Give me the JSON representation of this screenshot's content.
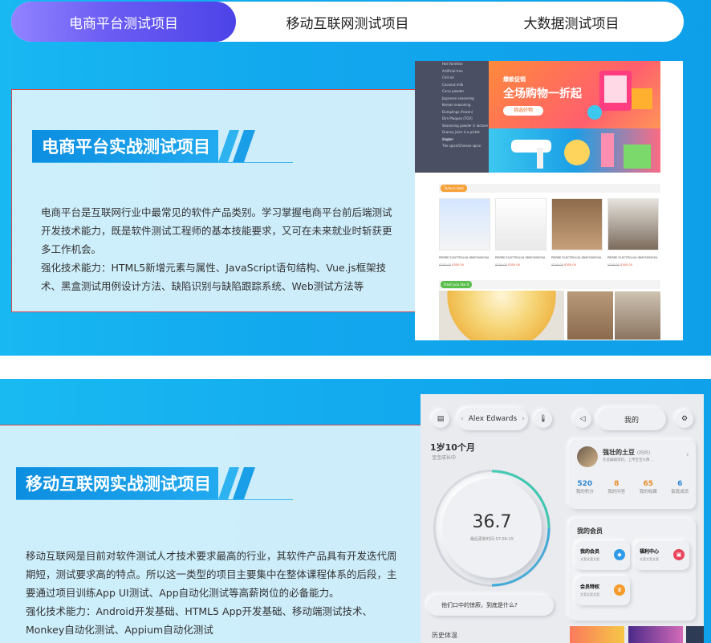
{
  "tabs": [
    {
      "label": "电商平台测试项目",
      "active": true
    },
    {
      "label": "移动互联网测试项目",
      "active": false
    },
    {
      "label": "大数据测试项目",
      "active": false
    }
  ],
  "section1": {
    "title": "电商平台实战测试项目",
    "para1": "电商平台是互联网行业中最常见的软件产品类别。学习掌握电商平台前后端测试开发技术能力，既是软件测试工程师的基本技能要求，又可在未来就业时斩获更多工作机会。",
    "para2": "强化技术能力：HTML5新增元素与属性、JavaScript语句结构、Vue.js框架技术、黑盒测试用例设计方法、缺陷识别与缺陷跟踪系统、Web测试方法等",
    "shop": {
      "menu": [
        "Hot Varieties",
        "Artificial tree",
        "Chili oil",
        "Coconut milk",
        "Curry powder",
        "Japanese seasoning",
        "Korean seasoning",
        "Dumplings (frozen)",
        "Dim Plaques (TGV)",
        "Seasoning powder is lactose",
        "Granny juice is a picket cracker",
        "Sugar",
        "The spice/Chinese spice"
      ],
      "banner_title": "爆款促销",
      "banner_sale": "全场购物一折起",
      "banner_btn": "挑选好物",
      "deal_label": "Today's deal",
      "product_name": "PIERRE ELECTROLUX IDM0300505A",
      "prices": [
        "$300.00",
        "$300.00",
        "$300.00",
        "$300.00"
      ],
      "old_prices": [
        "$700.00",
        "$700.00",
        "$700.00",
        "$700.00"
      ],
      "fresh_label": "Fresh you like it"
    }
  },
  "section2": {
    "title": "移动互联网实战测试项目",
    "para1": "移动互联网是目前对软件测试人才技术要求最高的行业，其软件产品具有开发迭代周期短，测试要求高的特点。所以这一类型的项目主要集中在整体课程体系的后段，主要通过项目训练App UI测试、App自动化测试等高薪岗位的必备能力。",
    "para2": "强化技术能力：Android开发基础、HTML5 App开发基础、移动端测试技术、Monkey自动化测试、Appium自动化测试",
    "app": {
      "user_pill": "Alex Edwards",
      "mine": "我的",
      "month": "1岁10个月",
      "month_sub": "宝宝成长中",
      "temp": "36.7",
      "temp_sub": "最后更新时间 07:56:15",
      "nick": "强壮的土豆",
      "nick_tag": "(妈妈)",
      "nick_sub": "在此编辑资料，上传宝宝头像…",
      "stats": [
        {
          "value": "520",
          "label": "我的积分",
          "color": "#2f87d6"
        },
        {
          "value": "8",
          "label": "我的问答",
          "color": "#e98c2a"
        },
        {
          "value": "65",
          "label": "我的收藏",
          "color": "#e98c2a"
        },
        {
          "value": "6",
          "label": "家庭成员",
          "color": "#2f87d6"
        }
      ],
      "member_title": "我的会员",
      "members": [
        {
          "label": "我的会员",
          "sub": "文案文案文案"
        },
        {
          "label": "福利中心",
          "sub": "文案文案文案"
        },
        {
          "label": "会员特权",
          "sub": "文案文案文案"
        }
      ],
      "tip": "他们口中的惊厥，到底是什么?",
      "bottom": "历史体温"
    }
  }
}
